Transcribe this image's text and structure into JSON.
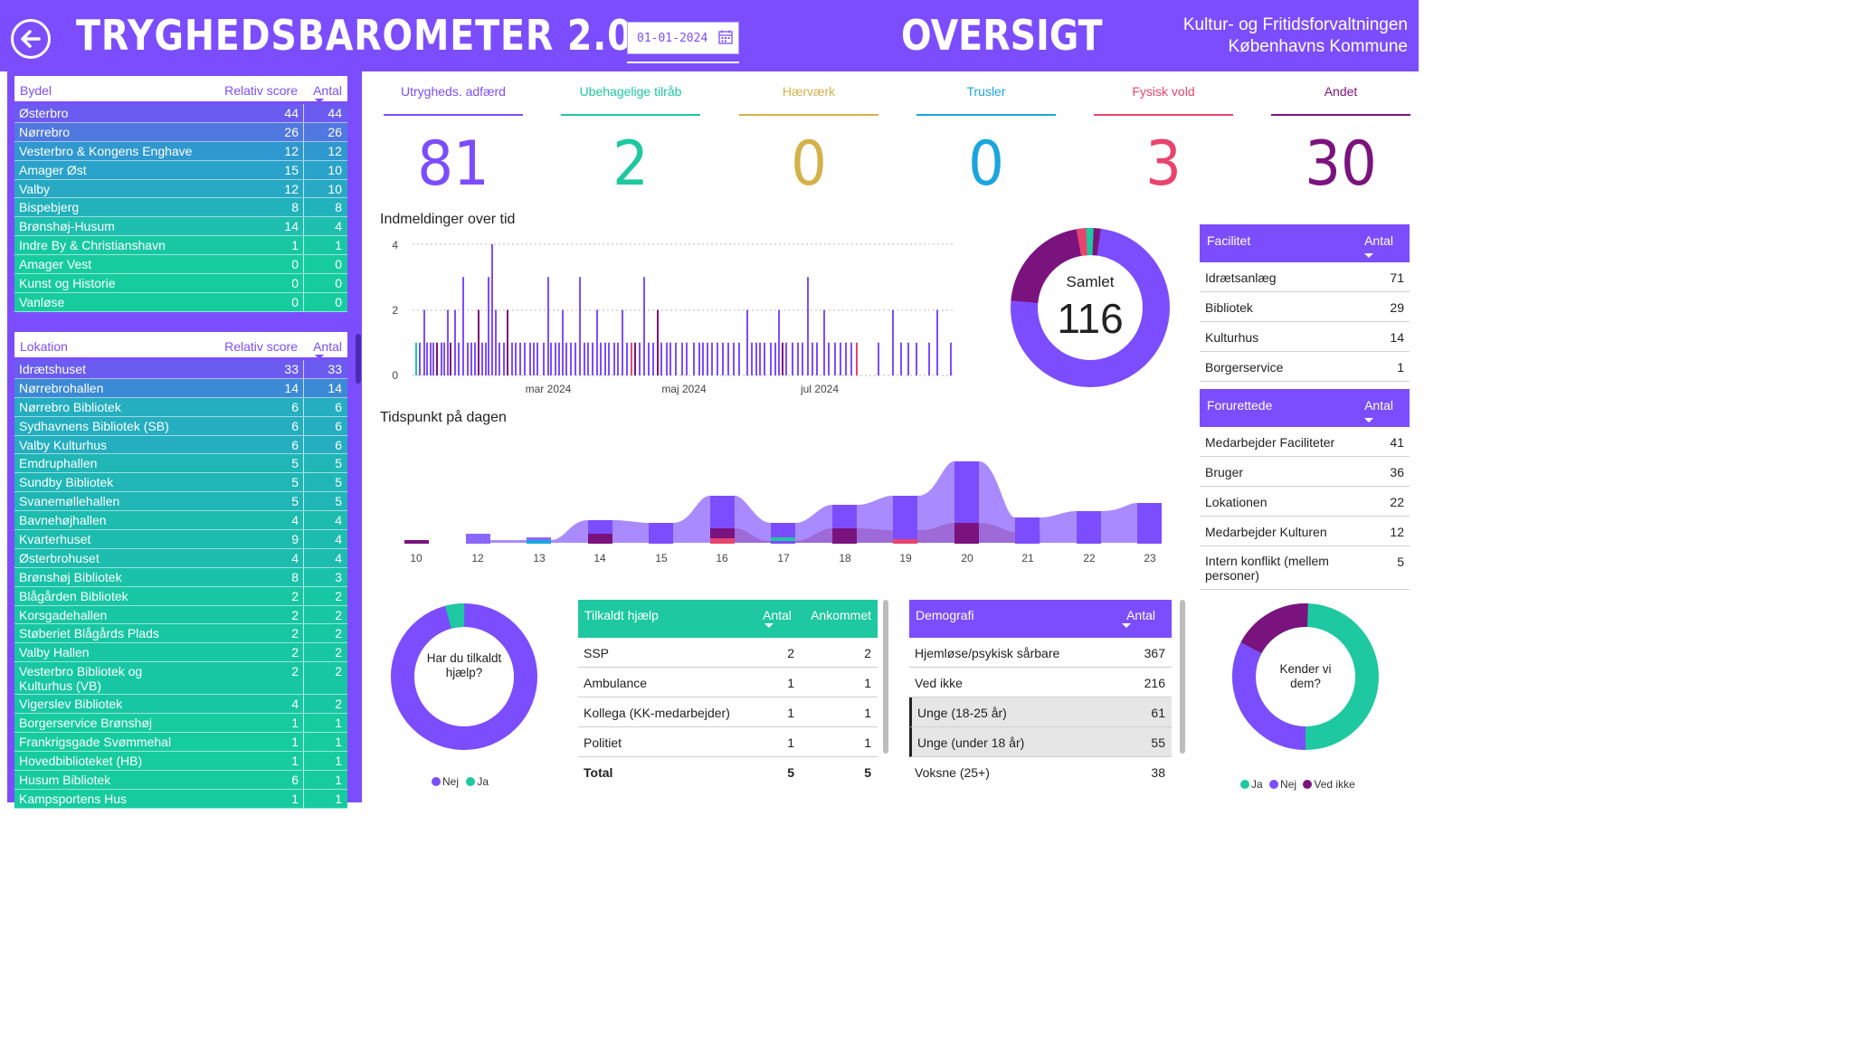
{
  "header": {
    "title": "TRYGHEDSBAROMETER 2.0",
    "date": "01-01-2024",
    "page": "OVERSIGT",
    "org_line1": "Kultur- og Fritidsforvaltningen",
    "org_line2": "Københavns Kommune"
  },
  "bydel": {
    "headers": {
      "name": "Bydel",
      "score": "Relativ score",
      "count": "Antal"
    },
    "rows": [
      {
        "name": "Østerbro",
        "score": "44",
        "count": "44",
        "color": "#6a5cf0"
      },
      {
        "name": "Nørrebro",
        "score": "26",
        "count": "26",
        "color": "#4f79e0"
      },
      {
        "name": "Vesterbro & Kongens Enghave",
        "score": "12",
        "count": "12",
        "color": "#2f98cf"
      },
      {
        "name": "Amager Øst",
        "score": "15",
        "count": "10",
        "color": "#29a3c9"
      },
      {
        "name": "Valby",
        "score": "12",
        "count": "10",
        "color": "#27a9c4"
      },
      {
        "name": "Bispebjerg",
        "score": "8",
        "count": "8",
        "color": "#22b2bb"
      },
      {
        "name": "Brønshøj-Husum",
        "score": "14",
        "count": "4",
        "color": "#1ebfae"
      },
      {
        "name": "Indre By & Christianshavn",
        "score": "1",
        "count": "1",
        "color": "#18c8a3"
      },
      {
        "name": "Amager Vest",
        "score": "0",
        "count": "0",
        "color": "#16cc9e"
      },
      {
        "name": "Kunst og Historie",
        "score": "0",
        "count": "0",
        "color": "#16cc9e"
      },
      {
        "name": "Vanløse",
        "score": "0",
        "count": "0",
        "color": "#16cc9e"
      }
    ]
  },
  "lokation": {
    "headers": {
      "name": "Lokation",
      "score": "Relativ score",
      "count": "Antal"
    },
    "rows": [
      {
        "name": "Idrætshuset",
        "score": "33",
        "count": "33",
        "color": "#6a5cf0"
      },
      {
        "name": "Nørrebrohallen",
        "score": "14",
        "count": "14",
        "color": "#3b8ad6"
      },
      {
        "name": "Nørrebro Bibliotek",
        "score": "6",
        "count": "6",
        "color": "#24aebf"
      },
      {
        "name": "Sydhavnens Bibliotek (SB)",
        "score": "6",
        "count": "6",
        "color": "#24aebf"
      },
      {
        "name": "Valby Kulturhus",
        "score": "6",
        "count": "6",
        "color": "#24aebf"
      },
      {
        "name": "Emdruphallen",
        "score": "5",
        "count": "5",
        "color": "#20b6b6"
      },
      {
        "name": "Sundby Bibliotek",
        "score": "5",
        "count": "5",
        "color": "#20b6b6"
      },
      {
        "name": "Svanemøllehallen",
        "score": "5",
        "count": "5",
        "color": "#20b6b6"
      },
      {
        "name": "Bavnehøjhallen",
        "score": "4",
        "count": "4",
        "color": "#1cbcae"
      },
      {
        "name": "Kvarterhuset",
        "score": "9",
        "count": "4",
        "color": "#1cbcae"
      },
      {
        "name": "Østerbrohuset",
        "score": "4",
        "count": "4",
        "color": "#1cbcae"
      },
      {
        "name": "Brønshøj Bibliotek",
        "score": "8",
        "count": "3",
        "color": "#19c2a8"
      },
      {
        "name": "Blågården Bibliotek",
        "score": "2",
        "count": "2",
        "color": "#17c7a3"
      },
      {
        "name": "Korsgadehallen",
        "score": "2",
        "count": "2",
        "color": "#17c7a3"
      },
      {
        "name": "Støberiet Blågårds Plads",
        "score": "2",
        "count": "2",
        "color": "#17c7a3"
      },
      {
        "name": "Valby Hallen",
        "score": "2",
        "count": "2",
        "color": "#17c7a3"
      },
      {
        "name": "Vesterbro Bibliotek og Kulturhus (VB)",
        "score": "2",
        "count": "2",
        "color": "#17c7a3",
        "tall": true
      },
      {
        "name": "Vigerslev Bibliotek",
        "score": "4",
        "count": "2",
        "color": "#17c7a3"
      },
      {
        "name": "Borgerservice Brønshøj",
        "score": "1",
        "count": "1",
        "color": "#16cc9e"
      },
      {
        "name": "Frankrigsgade Svømmehal",
        "score": "1",
        "count": "1",
        "color": "#16cc9e"
      },
      {
        "name": "Hovedbiblioteket (HB)",
        "score": "1",
        "count": "1",
        "color": "#16cc9e"
      },
      {
        "name": "Husum Bibliotek",
        "score": "6",
        "count": "1",
        "color": "#16cc9e"
      },
      {
        "name": "Kampsportens Hus",
        "score": "1",
        "count": "1",
        "color": "#16cc9e"
      }
    ]
  },
  "kpis": [
    {
      "label": "Utrygheds. adfærd",
      "value": "81",
      "color": "#7c4dff"
    },
    {
      "label": "Ubehagelige tilråb",
      "value": "2",
      "color": "#1ec8a0"
    },
    {
      "label": "Hærværk",
      "value": "0",
      "color": "#d4b14a"
    },
    {
      "label": "Trusler",
      "value": "0",
      "color": "#1aa6dd"
    },
    {
      "label": "Fysisk vold",
      "value": "3",
      "color": "#e8456e"
    },
    {
      "label": "Andet",
      "value": "30",
      "color": "#7b137e"
    }
  ],
  "timeline": {
    "title": "Indmeldinger over tid",
    "y_ticks": [
      "4",
      "2",
      "0"
    ],
    "x_ticks": [
      "mar 2024",
      "maj 2024",
      "jul 2024"
    ]
  },
  "hours": {
    "title": "Tidspunkt på dagen",
    "labels": [
      "10",
      "12",
      "13",
      "14",
      "15",
      "16",
      "17",
      "18",
      "19",
      "20",
      "21",
      "22",
      "23"
    ]
  },
  "samlet": {
    "label": "Samlet",
    "value": "116"
  },
  "facilitet": {
    "headers": {
      "name": "Facilitet",
      "count": "Antal"
    },
    "rows": [
      {
        "name": "Idrætsanlæg",
        "count": "71"
      },
      {
        "name": "Bibliotek",
        "count": "29"
      },
      {
        "name": "Kulturhus",
        "count": "14"
      },
      {
        "name": "Borgerservice",
        "count": "1"
      }
    ]
  },
  "forurettede": {
    "headers": {
      "name": "Forurettede",
      "count": "Antal"
    },
    "rows": [
      {
        "name": "Medarbejder Faciliteter",
        "count": "41"
      },
      {
        "name": "Bruger",
        "count": "36"
      },
      {
        "name": "Lokationen",
        "count": "22"
      },
      {
        "name": "Medarbejder Kulturen",
        "count": "12"
      },
      {
        "name": "Intern konflikt (mellem personer)",
        "count": "5",
        "tall": true
      }
    ]
  },
  "tilkaldt": {
    "headers": {
      "name": "Tilkaldt hjælp",
      "count": "Antal",
      "arrived": "Ankommet"
    },
    "rows": [
      {
        "name": "SSP",
        "count": "2",
        "arrived": "2"
      },
      {
        "name": "Ambulance",
        "count": "1",
        "arrived": "1"
      },
      {
        "name": "Kollega (KK-medarbejder)",
        "count": "1",
        "arrived": "1"
      },
      {
        "name": "Politiet",
        "count": "1",
        "arrived": "1"
      }
    ],
    "total": {
      "name": "Total",
      "count": "5",
      "arrived": "5"
    }
  },
  "demografi": {
    "headers": {
      "name": "Demografi",
      "count": "Antal"
    },
    "rows": [
      {
        "name": "Hjemløse/psykisk sårbare",
        "count": "367"
      },
      {
        "name": "Ved ikke",
        "count": "216"
      },
      {
        "name": "Unge (18-25 år)",
        "count": "61",
        "selected": true
      },
      {
        "name": "Unge (under 18 år)",
        "count": "55",
        "selected": true
      },
      {
        "name": "Voksne (25+)",
        "count": "38"
      }
    ]
  },
  "donut_help": {
    "center": "Har du tilkaldt hjælp?",
    "legend": [
      {
        "label": "Nej",
        "color": "#7c4dff"
      },
      {
        "label": "Ja",
        "color": "#1ec8a0"
      }
    ]
  },
  "donut_know": {
    "center": "Kender vi dem?",
    "legend": [
      {
        "label": "Ja",
        "color": "#1ec8a0"
      },
      {
        "label": "Nej",
        "color": "#7c4dff"
      },
      {
        "label": "Ved ikke",
        "color": "#7b137e"
      }
    ]
  }
}
